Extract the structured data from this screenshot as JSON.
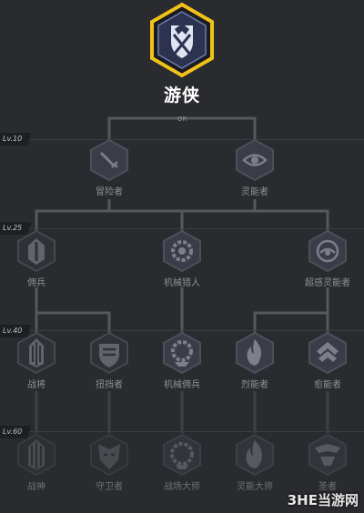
{
  "main_class": {
    "name": "游侠",
    "icon": "shield-crossed-swords-icon",
    "accent": "#f2c21b"
  },
  "or_label": "OR",
  "levels": [
    "Lv.10",
    "Lv.25",
    "Lv.40",
    "Lv.60"
  ],
  "tier1": [
    {
      "name": "冒险者",
      "icon": "sword-icon"
    },
    {
      "name": "灵能者",
      "icon": "eye-icon"
    }
  ],
  "tier2": [
    {
      "name": "佣兵",
      "icon": "helmet-icon"
    },
    {
      "name": "机械猎人",
      "icon": "gear-icon"
    },
    {
      "name": "超感灵能者",
      "icon": "orb-eye-icon"
    }
  ],
  "tier3": [
    {
      "name": "战将",
      "icon": "warlord-icon"
    },
    {
      "name": "扭挡者",
      "icon": "shield-icon"
    },
    {
      "name": "机械佣兵",
      "icon": "gear-helm-icon"
    },
    {
      "name": "烈能者",
      "icon": "flame-icon"
    },
    {
      "name": "愈能者",
      "icon": "chevron-wings-icon"
    }
  ],
  "tier4": [
    {
      "name": "战神",
      "icon": "warlord-crown-icon"
    },
    {
      "name": "守卫者",
      "icon": "guardian-mask-icon"
    },
    {
      "name": "战场大师",
      "icon": "gear-crown-icon"
    },
    {
      "name": "灵能大师",
      "icon": "flame-crown-icon"
    },
    {
      "name": "圣者",
      "icon": "winged-crest-icon"
    }
  ],
  "watermark": "3HE当游网"
}
